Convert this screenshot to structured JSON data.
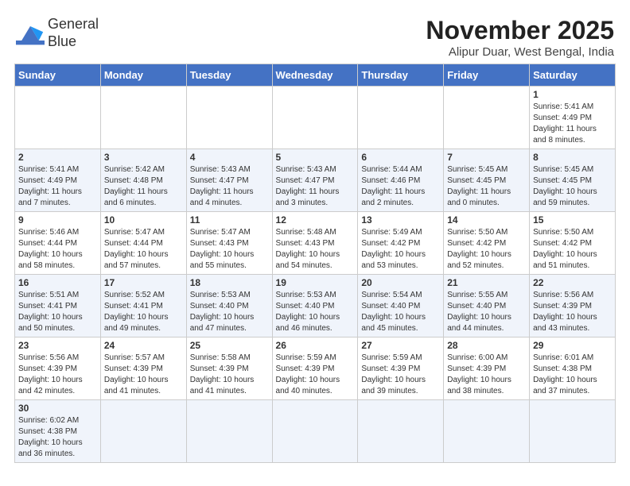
{
  "header": {
    "logo_line1": "General",
    "logo_line2": "Blue",
    "month_title": "November 2025",
    "location": "Alipur Duar, West Bengal, India"
  },
  "weekdays": [
    "Sunday",
    "Monday",
    "Tuesday",
    "Wednesday",
    "Thursday",
    "Friday",
    "Saturday"
  ],
  "weeks": [
    [
      {
        "day": "",
        "info": ""
      },
      {
        "day": "",
        "info": ""
      },
      {
        "day": "",
        "info": ""
      },
      {
        "day": "",
        "info": ""
      },
      {
        "day": "",
        "info": ""
      },
      {
        "day": "",
        "info": ""
      },
      {
        "day": "1",
        "info": "Sunrise: 5:41 AM\nSunset: 4:49 PM\nDaylight: 11 hours and 8 minutes."
      }
    ],
    [
      {
        "day": "2",
        "info": "Sunrise: 5:41 AM\nSunset: 4:49 PM\nDaylight: 11 hours and 7 minutes."
      },
      {
        "day": "3",
        "info": "Sunrise: 5:42 AM\nSunset: 4:48 PM\nDaylight: 11 hours and 6 minutes."
      },
      {
        "day": "4",
        "info": "Sunrise: 5:43 AM\nSunset: 4:47 PM\nDaylight: 11 hours and 4 minutes."
      },
      {
        "day": "5",
        "info": "Sunrise: 5:43 AM\nSunset: 4:47 PM\nDaylight: 11 hours and 3 minutes."
      },
      {
        "day": "6",
        "info": "Sunrise: 5:44 AM\nSunset: 4:46 PM\nDaylight: 11 hours and 2 minutes."
      },
      {
        "day": "7",
        "info": "Sunrise: 5:45 AM\nSunset: 4:45 PM\nDaylight: 11 hours and 0 minutes."
      },
      {
        "day": "8",
        "info": "Sunrise: 5:45 AM\nSunset: 4:45 PM\nDaylight: 10 hours and 59 minutes."
      }
    ],
    [
      {
        "day": "9",
        "info": "Sunrise: 5:46 AM\nSunset: 4:44 PM\nDaylight: 10 hours and 58 minutes."
      },
      {
        "day": "10",
        "info": "Sunrise: 5:47 AM\nSunset: 4:44 PM\nDaylight: 10 hours and 57 minutes."
      },
      {
        "day": "11",
        "info": "Sunrise: 5:47 AM\nSunset: 4:43 PM\nDaylight: 10 hours and 55 minutes."
      },
      {
        "day": "12",
        "info": "Sunrise: 5:48 AM\nSunset: 4:43 PM\nDaylight: 10 hours and 54 minutes."
      },
      {
        "day": "13",
        "info": "Sunrise: 5:49 AM\nSunset: 4:42 PM\nDaylight: 10 hours and 53 minutes."
      },
      {
        "day": "14",
        "info": "Sunrise: 5:50 AM\nSunset: 4:42 PM\nDaylight: 10 hours and 52 minutes."
      },
      {
        "day": "15",
        "info": "Sunrise: 5:50 AM\nSunset: 4:42 PM\nDaylight: 10 hours and 51 minutes."
      }
    ],
    [
      {
        "day": "16",
        "info": "Sunrise: 5:51 AM\nSunset: 4:41 PM\nDaylight: 10 hours and 50 minutes."
      },
      {
        "day": "17",
        "info": "Sunrise: 5:52 AM\nSunset: 4:41 PM\nDaylight: 10 hours and 49 minutes."
      },
      {
        "day": "18",
        "info": "Sunrise: 5:53 AM\nSunset: 4:40 PM\nDaylight: 10 hours and 47 minutes."
      },
      {
        "day": "19",
        "info": "Sunrise: 5:53 AM\nSunset: 4:40 PM\nDaylight: 10 hours and 46 minutes."
      },
      {
        "day": "20",
        "info": "Sunrise: 5:54 AM\nSunset: 4:40 PM\nDaylight: 10 hours and 45 minutes."
      },
      {
        "day": "21",
        "info": "Sunrise: 5:55 AM\nSunset: 4:40 PM\nDaylight: 10 hours and 44 minutes."
      },
      {
        "day": "22",
        "info": "Sunrise: 5:56 AM\nSunset: 4:39 PM\nDaylight: 10 hours and 43 minutes."
      }
    ],
    [
      {
        "day": "23",
        "info": "Sunrise: 5:56 AM\nSunset: 4:39 PM\nDaylight: 10 hours and 42 minutes."
      },
      {
        "day": "24",
        "info": "Sunrise: 5:57 AM\nSunset: 4:39 PM\nDaylight: 10 hours and 41 minutes."
      },
      {
        "day": "25",
        "info": "Sunrise: 5:58 AM\nSunset: 4:39 PM\nDaylight: 10 hours and 41 minutes."
      },
      {
        "day": "26",
        "info": "Sunrise: 5:59 AM\nSunset: 4:39 PM\nDaylight: 10 hours and 40 minutes."
      },
      {
        "day": "27",
        "info": "Sunrise: 5:59 AM\nSunset: 4:39 PM\nDaylight: 10 hours and 39 minutes."
      },
      {
        "day": "28",
        "info": "Sunrise: 6:00 AM\nSunset: 4:39 PM\nDaylight: 10 hours and 38 minutes."
      },
      {
        "day": "29",
        "info": "Sunrise: 6:01 AM\nSunset: 4:38 PM\nDaylight: 10 hours and 37 minutes."
      }
    ],
    [
      {
        "day": "30",
        "info": "Sunrise: 6:02 AM\nSunset: 4:38 PM\nDaylight: 10 hours and 36 minutes."
      },
      {
        "day": "",
        "info": ""
      },
      {
        "day": "",
        "info": ""
      },
      {
        "day": "",
        "info": ""
      },
      {
        "day": "",
        "info": ""
      },
      {
        "day": "",
        "info": ""
      },
      {
        "day": "",
        "info": ""
      }
    ]
  ]
}
